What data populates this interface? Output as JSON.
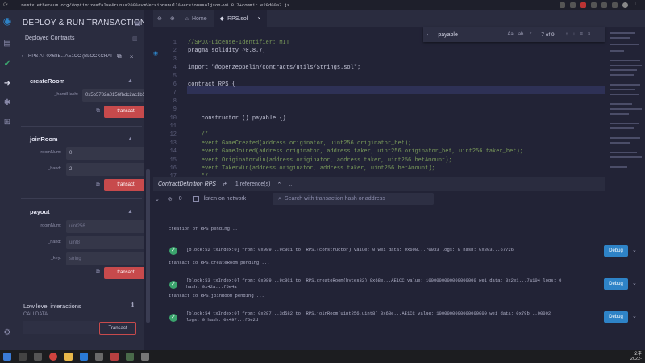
{
  "browser": {
    "url": "remix.ethereum.org/#optimize=false&runs=200&evmVersion=null&version=soljson-v0.8.7+commit.e28d00a7.js"
  },
  "panel": {
    "title": "DEPLOY & RUN TRANSACTIONS",
    "deployed_label": "Deployed Contracts",
    "instance_label": "RPS AT 0X68E...AE1CC (BLOCKCHAI",
    "functions": [
      {
        "name": "createRoom",
        "params": [
          {
            "label": "_handHash:",
            "value": "0x5b5782a0156fbdc2ac1b52",
            "placeholder": false
          }
        ],
        "button": "transact"
      },
      {
        "name": "joinRoom",
        "params": [
          {
            "label": "roomNum:",
            "value": "0",
            "placeholder": false
          },
          {
            "label": "_hand:",
            "value": "2",
            "placeholder": false
          }
        ],
        "button": "transact"
      },
      {
        "name": "payout",
        "params": [
          {
            "label": "roomNum:",
            "value": "uint256",
            "placeholder": true
          },
          {
            "label": "_hand:",
            "value": "uint8",
            "placeholder": true
          },
          {
            "label": "_key:",
            "value": "string",
            "placeholder": true
          }
        ],
        "button": "transact"
      }
    ],
    "low_level": {
      "title": "Low level interactions",
      "calldata_label": "CALLDATA",
      "button": "Transact"
    }
  },
  "editor": {
    "tabs": [
      {
        "label": "Home",
        "icon": "home-icon"
      },
      {
        "label": "RPS.sol",
        "icon": "solidity-file-icon"
      }
    ],
    "lines": [
      {
        "num": "1",
        "text": "//SPDX-License-Identifier: MIT",
        "color": "#7a9a5a"
      },
      {
        "num": "2",
        "text": "pragma solidity ^0.8.7;",
        "color": "#c8c9dc"
      },
      {
        "num": "3",
        "text": "",
        "color": "#c8c9dc"
      },
      {
        "num": "4",
        "text": "import \"@openzeppelin/contracts/utils/Strings.sol\";",
        "color": "#c8c9dc"
      },
      {
        "num": "5",
        "text": "",
        "color": "#c8c9dc"
      },
      {
        "num": "6",
        "text": "contract RPS {",
        "color": "#c8c9dc"
      },
      {
        "num": "7",
        "text": "",
        "color": "#c8c9dc"
      },
      {
        "num": "8",
        "text": "",
        "color": "#c8c9dc"
      },
      {
        "num": "9",
        "text": "",
        "color": "#c8c9dc"
      },
      {
        "num": "10",
        "text": "    constructor () payable {}",
        "color": "#c8c9dc"
      },
      {
        "num": "11",
        "text": "",
        "color": "#c8c9dc"
      },
      {
        "num": "12",
        "text": "    /*",
        "color": "#7a9a5a"
      },
      {
        "num": "13",
        "text": "    event GameCreated(address originator, uint256 originator_bet);",
        "color": "#7a9a5a"
      },
      {
        "num": "14",
        "text": "    event GameJoined(address originator, address taker, uint256 originator_bet, uint256 taker_bet);",
        "color": "#7a9a5a"
      },
      {
        "num": "15",
        "text": "    event OriginatorWin(address originator, address taker, uint256 betAmount);",
        "color": "#7a9a5a"
      },
      {
        "num": "16",
        "text": "    event TakerWin(address originator, address taker, uint256 betAmount);",
        "color": "#7a9a5a"
      },
      {
        "num": "17",
        "text": "    */",
        "color": "#7a9a5a"
      }
    ],
    "find": {
      "query": "payable",
      "count": "7 of 9",
      "match_case": "Aa",
      "whole_word": "ab",
      "regex": ".*"
    },
    "definition_bar": {
      "label": "ContractDefinition RPS",
      "references": "1 reference(s)"
    }
  },
  "terminal": {
    "count": "0",
    "listen_label": "listen on network",
    "search_placeholder": "Search with transaction hash or address",
    "pending_intro": "creation of RPS pending...",
    "transactions": [
      {
        "line1": "[block:52 txIndex:0]  from: 0x989...9c8C1 to: RPS.(constructor) value: 0 wei data: 0x608...70033 logs: 0 hash: 0x803...67726",
        "line2": "",
        "after": "transact to RPS.createRoom pending ..."
      },
      {
        "line1": "[block:53 txIndex:0]  from: 0x989...9c8C1 to: RPS.createRoom(bytes32) 0x68e...AE1CC value: 1000000000000000000 wei data: 0x2e1...7a104 logs: 0",
        "line2": "hash: 0x42a...f5e4a",
        "after": "transact to RPS.joinRoom pending ..."
      },
      {
        "line1": "[block:54 txIndex:0]  from: 0x287...3d582 to: RPS.joinRoom(uint256,uint8) 0x68e...AE1CC value: 1000000000000000000 wei data: 0x79b...00002",
        "line2": "logs: 0 hash: 0x497...f5e2d",
        "after": ""
      }
    ],
    "debug_label": "Debug"
  },
  "taskbar": {
    "time": "오후",
    "date": "2022-"
  }
}
